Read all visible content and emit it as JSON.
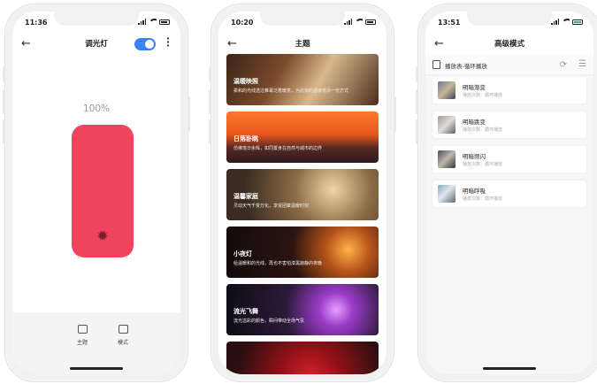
{
  "phone1": {
    "time": "11:36",
    "title": "调光灯",
    "toggle_on": true,
    "brightness_label": "100%",
    "brightness": 100,
    "lamp_color": "#f0435d",
    "nav": [
      {
        "label": "主题",
        "icon": "theme-icon"
      },
      {
        "label": "模式",
        "icon": "mode-icon"
      }
    ]
  },
  "phone2": {
    "time": "10:20",
    "title": "主题",
    "themes": [
      {
        "title": "温暖映照",
        "desc": "柔和的光线透过帷幕泛着暖意，为此刻的温暖增添一份方式"
      },
      {
        "title": "日落卧眺",
        "desc": "仿佛落日余晖，如同置身在自然与城市的边界"
      },
      {
        "title": "温馨家庭",
        "desc": "灵动天气千变万化，享受团聚温暖时刻"
      },
      {
        "title": "小夜灯",
        "desc": "给温暖和的光线，再也不害怕漆黑寂静的夜晚"
      },
      {
        "title": "流光飞舞",
        "desc": "流光溢彩的颜色，瞬间带动全场气氛"
      },
      {
        "title": "",
        "desc": ""
      }
    ]
  },
  "phone3": {
    "time": "13:51",
    "title": "高级模式",
    "playlist_label": "播放表-循环播放",
    "modes": [
      {
        "name": "明暗渐变",
        "sub": "播放次数：循环播放"
      },
      {
        "name": "明暗跳变",
        "sub": "播放次数：循环播放"
      },
      {
        "name": "明暗频闪",
        "sub": "播放次数：循环播放"
      },
      {
        "name": "明暗呼吸",
        "sub": "播放次数：循环播放"
      }
    ]
  }
}
